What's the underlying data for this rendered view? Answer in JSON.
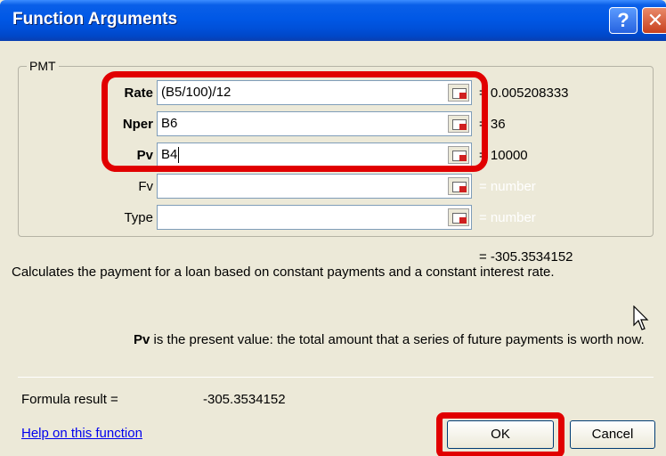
{
  "window": {
    "title": "Function Arguments",
    "help_glyph": "?",
    "close_glyph": "✕"
  },
  "group": {
    "label": "PMT"
  },
  "args": [
    {
      "name": "Rate",
      "value": "(B5/100)/12",
      "result": "= 0.005208333"
    },
    {
      "name": "Nper",
      "value": "B6",
      "result": "= 36"
    },
    {
      "name": "Pv",
      "value": "B4",
      "result": "= 10000"
    },
    {
      "name": "Fv",
      "value": "",
      "result": "= number"
    },
    {
      "name": "Type",
      "value": "",
      "result": "= number"
    }
  ],
  "function_result": "= -305.3534152",
  "description": "Calculates the payment for a loan based on constant payments and a constant interest rate.",
  "arg_help": {
    "name": "Pv",
    "text": " is the present value: the total amount that a series of future payments is worth now."
  },
  "formula_result": {
    "label": "Formula result =",
    "value": "-305.3534152"
  },
  "help_link": "Help on this function",
  "buttons": {
    "ok": "OK",
    "cancel": "Cancel"
  },
  "colors": {
    "highlight": "#e10000",
    "titlebar": "#0058e6"
  },
  "icons": [
    "help-icon",
    "close-icon",
    "collapse-dialog-icon",
    "mouse-pointer-icon"
  ]
}
